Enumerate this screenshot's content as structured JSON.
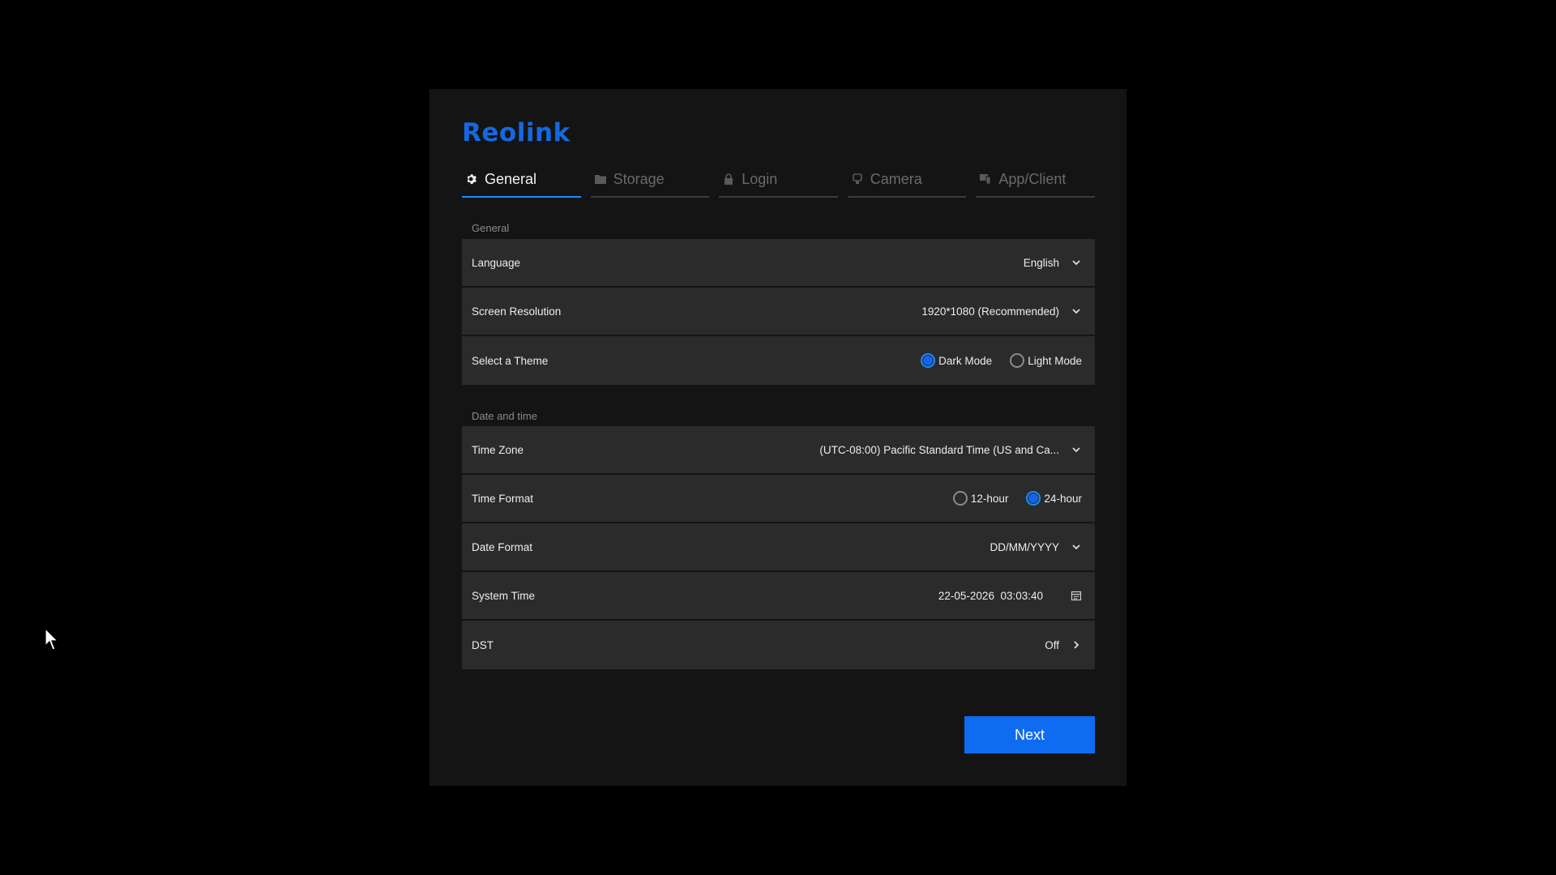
{
  "app": {
    "logo_text": "Reolink",
    "accent_color": "#1569e0"
  },
  "tabs": [
    {
      "label": "General",
      "icon": "gear-icon",
      "active": true
    },
    {
      "label": "Storage",
      "icon": "folder-icon",
      "active": false
    },
    {
      "label": "Login",
      "icon": "lock-icon",
      "active": false
    },
    {
      "label": "Camera",
      "icon": "camera-icon",
      "active": false
    },
    {
      "label": "App/Client",
      "icon": "devices-icon",
      "active": false
    }
  ],
  "general": {
    "section_title": "General",
    "language": {
      "label": "Language",
      "value": "English"
    },
    "resolution": {
      "label": "Screen Resolution",
      "value": "1920*1080 (Recommended)"
    },
    "theme": {
      "label": "Select a Theme",
      "options": [
        {
          "label": "Dark Mode",
          "selected": true
        },
        {
          "label": "Light Mode",
          "selected": false
        }
      ]
    }
  },
  "datetime": {
    "section_title": "Date and time",
    "timezone": {
      "label": "Time Zone",
      "value": "(UTC-08:00) Pacific Standard Time (US and Ca..."
    },
    "time_format": {
      "label": "Time Format",
      "options": [
        {
          "label": "12-hour",
          "selected": false
        },
        {
          "label": "24-hour",
          "selected": true
        }
      ]
    },
    "date_format": {
      "label": "Date Format",
      "value": "DD/MM/YYYY"
    },
    "system_time": {
      "label": "System Time",
      "value": "22-05-2026  03:03:40"
    },
    "dst": {
      "label": "DST",
      "value": "Off"
    }
  },
  "actions": {
    "next_label": "Next"
  }
}
